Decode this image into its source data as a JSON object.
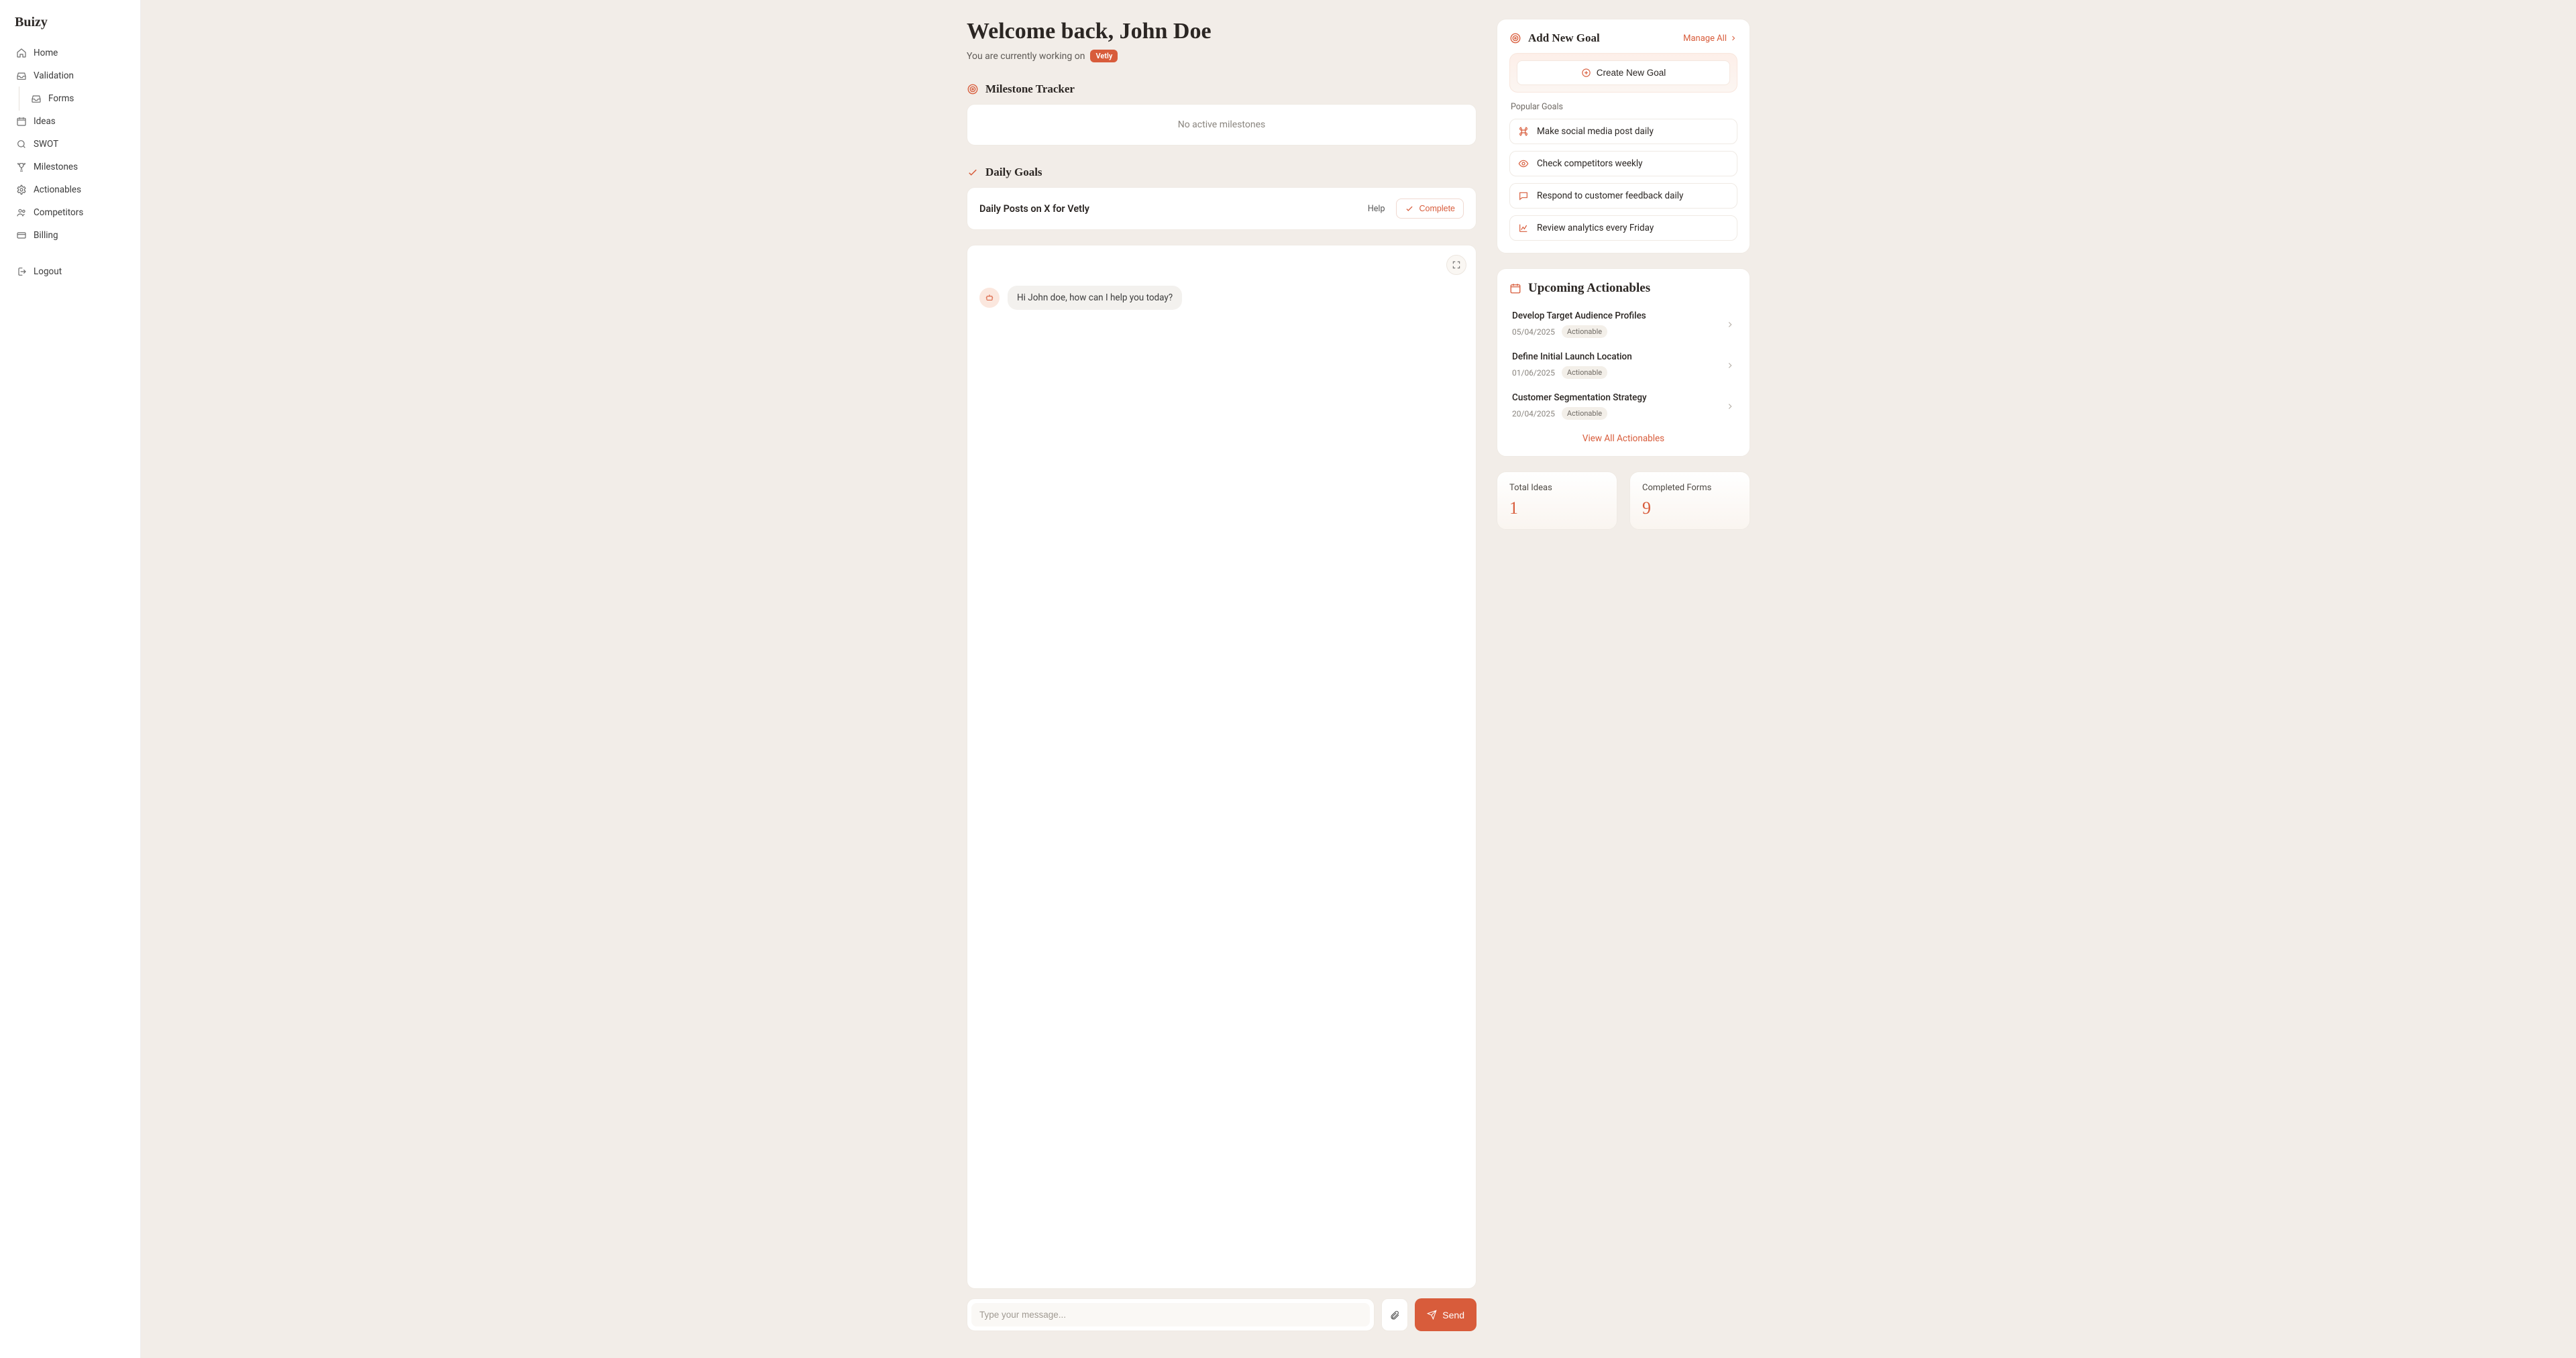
{
  "brand": "Buizy",
  "nav": {
    "home": "Home",
    "validation": "Validation",
    "forms": "Forms",
    "ideas": "Ideas",
    "swot": "SWOT",
    "milestones": "Milestones",
    "actionables": "Actionables",
    "competitors": "Competitors",
    "billing": "Billing",
    "logout": "Logout"
  },
  "header": {
    "welcome": "Welcome back, John Doe",
    "subline": "You are currently working on",
    "project_badge": "Vetly"
  },
  "milestone": {
    "section_title": "Milestone Tracker",
    "empty_text": "No active milestones"
  },
  "goals_section": {
    "title": "Daily Goals",
    "goal_title": "Daily Posts on X for Vetly",
    "help_label": "Help",
    "complete_label": "Complete"
  },
  "chat": {
    "bot_message": "Hi John doe, how can I help you today?",
    "input_placeholder": "Type your message...",
    "send_label": "Send"
  },
  "add_goal_panel": {
    "title": "Add New Goal",
    "manage_label": "Manage All",
    "create_label": "Create New Goal",
    "popular_label": "Popular Goals",
    "popular": [
      "Make social media post daily",
      "Check competitors weekly",
      "Respond to customer feedback daily",
      "Review analytics every Friday"
    ]
  },
  "upcoming_panel": {
    "title": "Upcoming Actionables",
    "items": [
      {
        "title": "Develop Target Audience Profiles",
        "date": "05/04/2025",
        "badge": "Actionable"
      },
      {
        "title": "Define Initial Launch Location",
        "date": "01/06/2025",
        "badge": "Actionable"
      },
      {
        "title": "Customer Segmentation Strategy",
        "date": "20/04/2025",
        "badge": "Actionable"
      }
    ],
    "view_all_label": "View All Actionables"
  },
  "stats": {
    "ideas_label": "Total Ideas",
    "ideas_value": "1",
    "forms_label": "Completed Forms",
    "forms_value": "9"
  }
}
